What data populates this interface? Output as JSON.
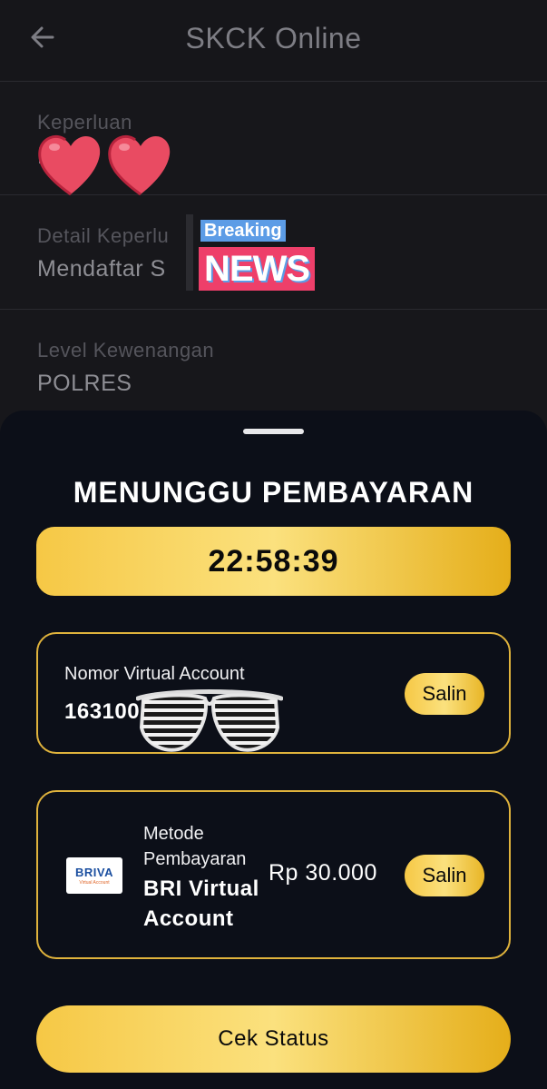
{
  "header": {
    "title": "SKCK Online",
    "back_icon": "arrow-left-icon"
  },
  "fields": [
    {
      "label": "Keperluan",
      "value": "P  j"
    },
    {
      "label": "Detail Keperlu",
      "value": "Mendaftar S"
    },
    {
      "label": "Level Kewenangan",
      "value": "POLRES"
    }
  ],
  "stickers": {
    "breaking_top": "Breaking",
    "breaking_bottom": "NEWS",
    "hearts_icon": "hearts-sticker-icon",
    "glasses_icon": "shutter-shades-sticker-icon"
  },
  "sheet": {
    "title": "MENUNGGU PEMBAYARAN",
    "timer": "22:58:39",
    "virtual_account": {
      "label": "Nomor Virtual Account",
      "number": "163100",
      "copy_label": "Salin"
    },
    "payment": {
      "logo_text": "BRIVA",
      "logo_subtext": "Virtual Account",
      "method_label": "Metode Pembayaran",
      "method_value": "BRI Virtual Account",
      "amount": "Rp 30.000",
      "copy_label": "Salin"
    },
    "status_button": "Cek Status"
  },
  "colors": {
    "background": "#17171b",
    "sheet": "#0c0f18",
    "gold": "#f6c845",
    "gold_border": "#e0b33c"
  }
}
